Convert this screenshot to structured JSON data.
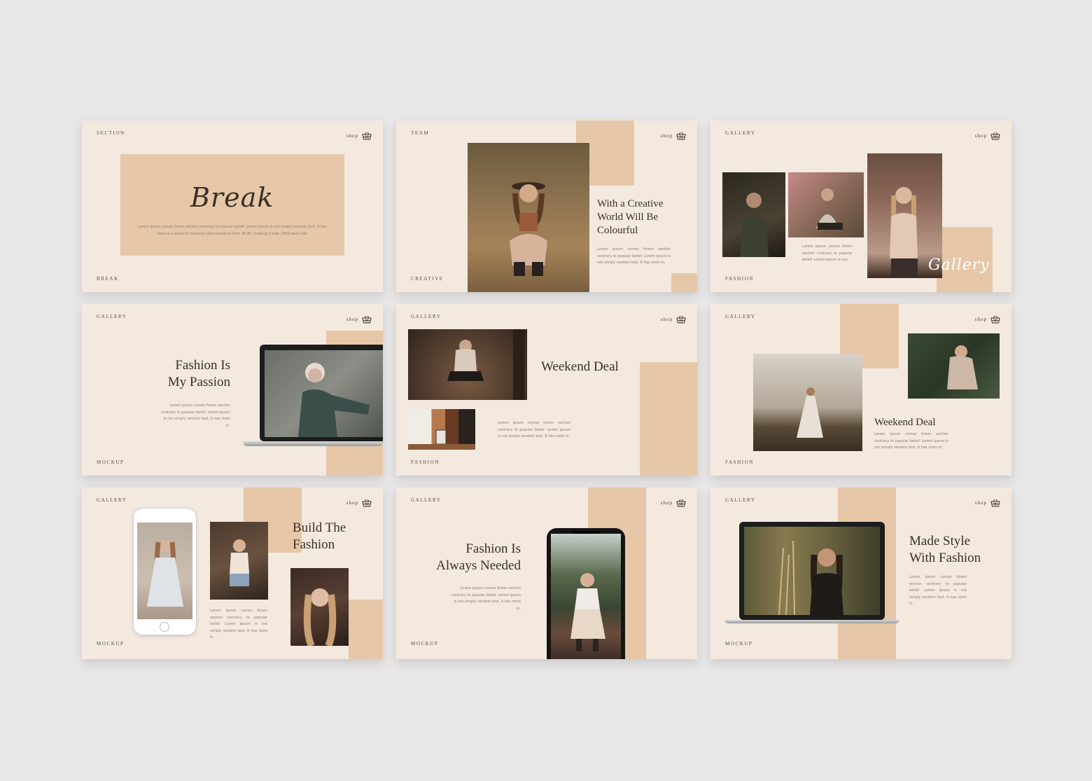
{
  "colors": {
    "page_bg": "#e8e6e6",
    "slide_bg": "#f4e9df",
    "accent_block": "#e6c8a8",
    "text_dark": "#3a2e28"
  },
  "icons": {
    "shop": "basket-icon"
  },
  "slides": [
    {
      "top_label": "SECTION",
      "bottom_label": "BREAK",
      "shop": "shop",
      "script_title": "Break",
      "body": "Lorem ipsum comes forem section contrary to popular belief. Lorem ipsum is not simply random text. It has roots in a piece of classical Latin literature from 45 BC, making it over 2000 years old."
    },
    {
      "top_label": "TEAM",
      "bottom_label": "CREATIVE",
      "shop": "shop",
      "heading": "With a Creative\nWorld Will Be\nColourful",
      "body": "Lorem ipsum comes forem section contrary to popular belief. Lorem ipsum is not simply random text. It has roots in."
    },
    {
      "top_label": "GALLERY",
      "bottom_label": "FASHION",
      "shop": "shop",
      "script_title": "Gallery",
      "body": "Lorem ipsum comes forem section contrary to popular belief. Lorem ipsum is not."
    },
    {
      "top_label": "GALLERY",
      "bottom_label": "MOCKUP",
      "shop": "shop",
      "heading": "Fashion Is\nMy Passion",
      "body": "Lorem ipsum comes forem section contrary to popular belief. Lorem ipsum is not simply random text. It has roots in."
    },
    {
      "top_label": "GALLERY",
      "bottom_label": "FASHION",
      "shop": "shop",
      "heading": "Weekend Deal",
      "body": "Lorem ipsum comes forem section contrary to popular belief. Lorem ipsum is not simply random text. It has roots in."
    },
    {
      "top_label": "GALLERY",
      "bottom_label": "FASHION",
      "shop": "shop",
      "heading": "Weekend Deal",
      "body": "Lorem ipsum comes forem section contrary to popular belief. Lorem ipsum is not simply random text. It has roots in."
    },
    {
      "top_label": "GALLERY",
      "bottom_label": "MOCKUP",
      "shop": "shop",
      "heading": "Build The\nFashion",
      "body": "Lorem ipsum comes forem section contrary to popular belief. Lorem ipsum is not simply random text. It has roots in."
    },
    {
      "top_label": "GALLERY",
      "bottom_label": "MOCKUP",
      "shop": "shop",
      "heading": "Fashion Is\nAlways Needed",
      "body": "Lorem ipsum comes forem section contrary to popular belief. Lorem ipsum is not simply random text. It has roots in."
    },
    {
      "top_label": "GALLERY",
      "bottom_label": "MOCKUP",
      "shop": "shop",
      "heading": "Made Style\nWith Fashion",
      "body": "Lorem ipsum comes forem section contrary to popular belief. Lorem ipsum is not simply random text. It has roots in."
    }
  ]
}
